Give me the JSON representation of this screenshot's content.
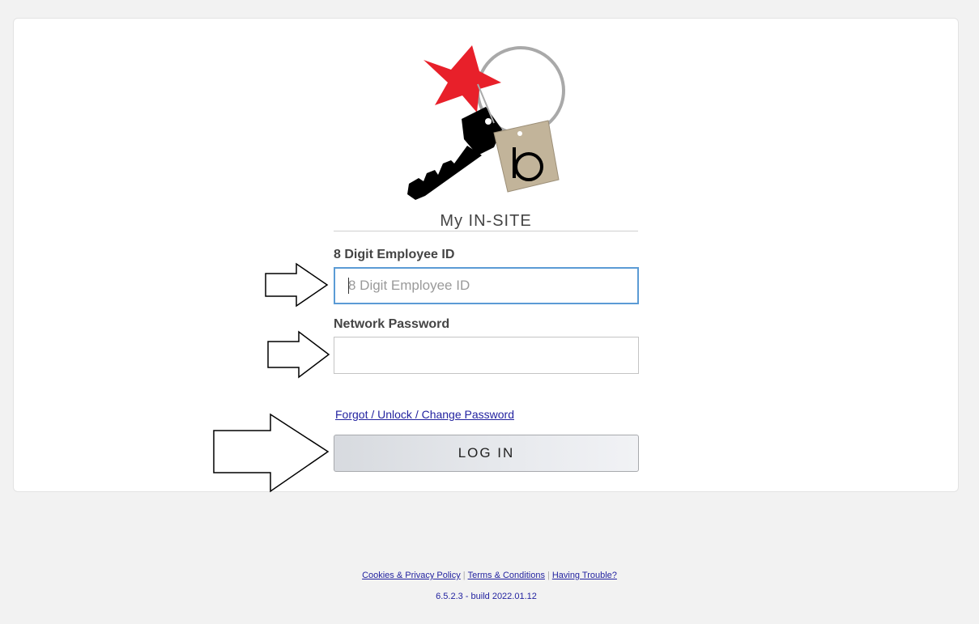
{
  "app": {
    "title": "My IN-SITE"
  },
  "form": {
    "employee_id": {
      "label": "8 Digit Employee ID",
      "placeholder": "8 Digit Employee ID",
      "value": ""
    },
    "password": {
      "label": "Network Password",
      "value": ""
    },
    "forgot_link": "Forgot / Unlock / Change Password",
    "login_button": "LOG IN"
  },
  "footer": {
    "links": [
      "Cookies & Privacy Policy",
      "Terms & Conditions",
      "Having Trouble?"
    ],
    "version": "6.5.2.3 - build 2022.01.12"
  },
  "icons": {
    "logo": "key-with-star-and-b-tag-logo",
    "arrows": [
      "arrow-right-icon",
      "arrow-right-icon",
      "arrow-right-icon"
    ]
  },
  "colors": {
    "star": "#e8202a",
    "tag": "#c2b49a",
    "focus_border": "#5b9bd5",
    "link": "#2323a0"
  }
}
